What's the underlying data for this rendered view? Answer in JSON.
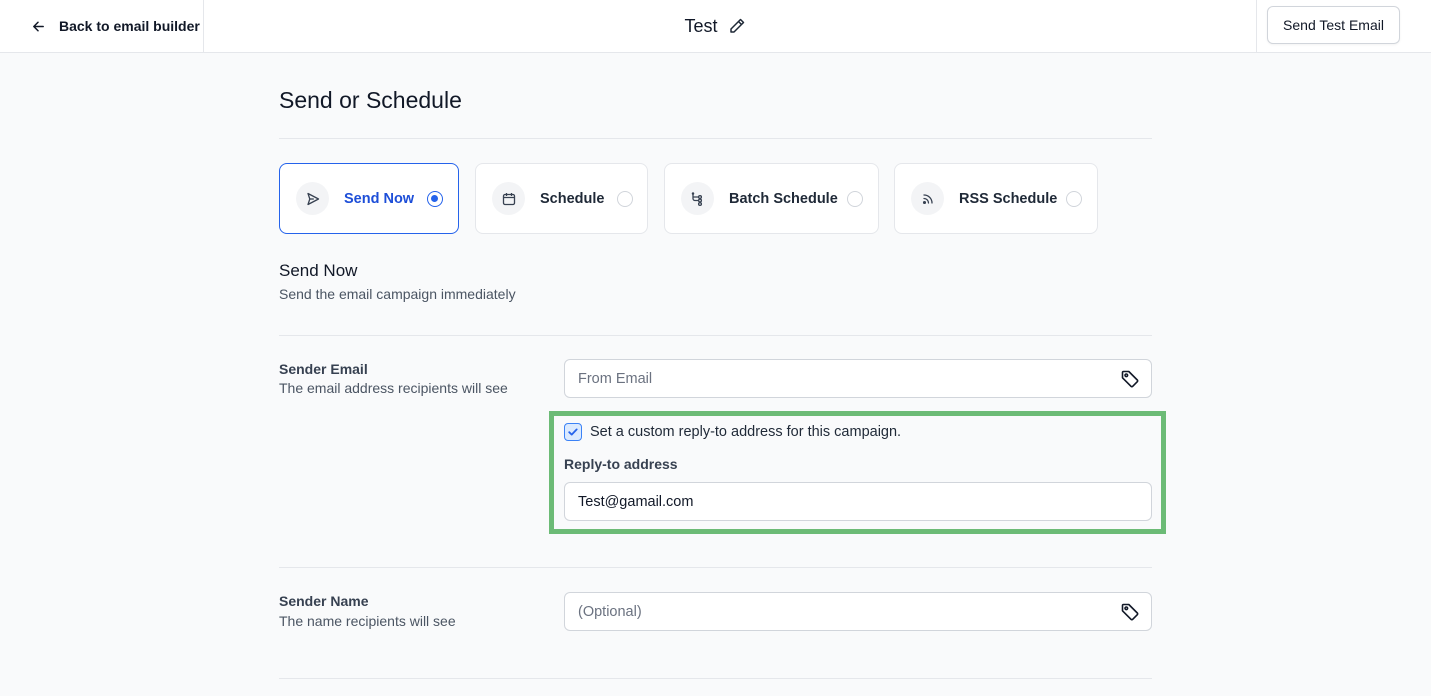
{
  "header": {
    "back_label": "Back to email builder",
    "title": "Test",
    "send_test_label": "Send Test Email"
  },
  "page": {
    "title": "Send or Schedule"
  },
  "options": [
    {
      "label": "Send Now",
      "icon": "send-icon",
      "selected": true
    },
    {
      "label": "Schedule",
      "icon": "calendar-icon",
      "selected": false
    },
    {
      "label": "Batch Schedule",
      "icon": "batch-icon",
      "selected": false
    },
    {
      "label": "RSS Schedule",
      "icon": "rss-icon",
      "selected": false
    }
  ],
  "section": {
    "title": "Send Now",
    "subtitle": "Send the email campaign immediately"
  },
  "sender_email": {
    "label": "Sender Email",
    "help": "The email address recipients will see",
    "placeholder": "From Email",
    "value": ""
  },
  "reply_to": {
    "checkbox_label": "Set a custom reply-to address for this campaign.",
    "checked": true,
    "label": "Reply-to address",
    "value": "Test@gamail.com"
  },
  "sender_name": {
    "label": "Sender Name",
    "help": "The name recipients will see",
    "placeholder": "(Optional)",
    "value": ""
  },
  "colors": {
    "accent": "#2563eb",
    "highlight": "#6cbb76"
  }
}
